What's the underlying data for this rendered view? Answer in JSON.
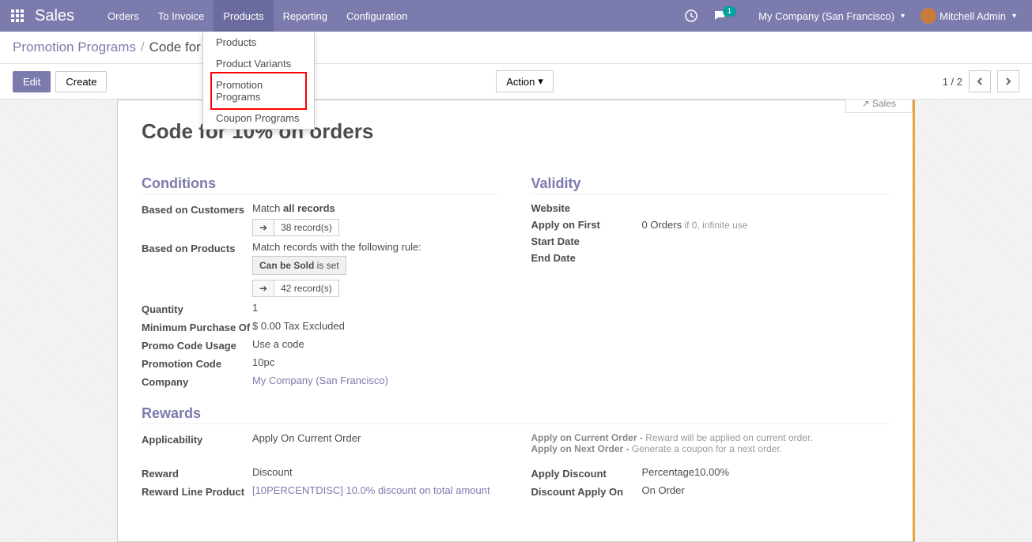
{
  "navbar": {
    "brand": "Sales",
    "items": [
      "Orders",
      "To Invoice",
      "Products",
      "Reporting",
      "Configuration"
    ],
    "active_index": 2,
    "chat_count": "1",
    "company": "My Company (San Francisco)",
    "user": "Mitchell Admin"
  },
  "dropdown": {
    "items": [
      "Products",
      "Product Variants",
      "Promotion Programs",
      "Coupon Programs"
    ]
  },
  "breadcrumb": {
    "parent": "Promotion Programs",
    "current": "Code for 10..."
  },
  "buttons": {
    "edit": "Edit",
    "create": "Create",
    "action": "Action"
  },
  "pager": {
    "text": "1 / 2"
  },
  "smart_button": "Sales",
  "title": "Code for 10% on orders",
  "conditions": {
    "heading": "Conditions",
    "based_on_customers_label": "Based on Customers",
    "match_prefix": "Match ",
    "match_bold": "all records",
    "records_38": "38 record(s)",
    "based_on_products_label": "Based on Products",
    "match_rule_text": "Match records with the following rule:",
    "rule_field": "Can be Sold",
    "rule_suffix": " is set",
    "records_42": "42 record(s)",
    "quantity_label": "Quantity",
    "quantity_value": "1",
    "min_purchase_label": "Minimum Purchase Of",
    "min_purchase_value": "$ 0.00  Tax Excluded",
    "promo_usage_label": "Promo Code Usage",
    "promo_usage_value": "Use a code",
    "promo_code_label": "Promotion Code",
    "promo_code_value": "10pc",
    "company_label": "Company",
    "company_value": "My Company (San Francisco)"
  },
  "validity": {
    "heading": "Validity",
    "website_label": "Website",
    "apply_first_label": "Apply on First",
    "apply_first_value": "0 Orders",
    "apply_first_help": " if 0, infinite use",
    "start_date_label": "Start Date",
    "end_date_label": "End Date"
  },
  "rewards": {
    "heading": "Rewards",
    "applicability_label": "Applicability",
    "applicability_value": "Apply On Current Order",
    "help_current_label": "Apply on Current Order - ",
    "help_current_text": "Reward will be applied on current order.",
    "help_next_label": "Apply on Next Order - ",
    "help_next_text": "Generate a coupon for a next order.",
    "reward_label": "Reward",
    "reward_value": "Discount",
    "reward_line_label": "Reward Line Product",
    "reward_line_value": "[10PERCENTDISC] 10.0% discount on total amount",
    "apply_discount_label": "Apply Discount",
    "apply_discount_value": "Percentage10.00%",
    "discount_apply_on_label": "Discount Apply On",
    "discount_apply_on_value": "On Order"
  }
}
